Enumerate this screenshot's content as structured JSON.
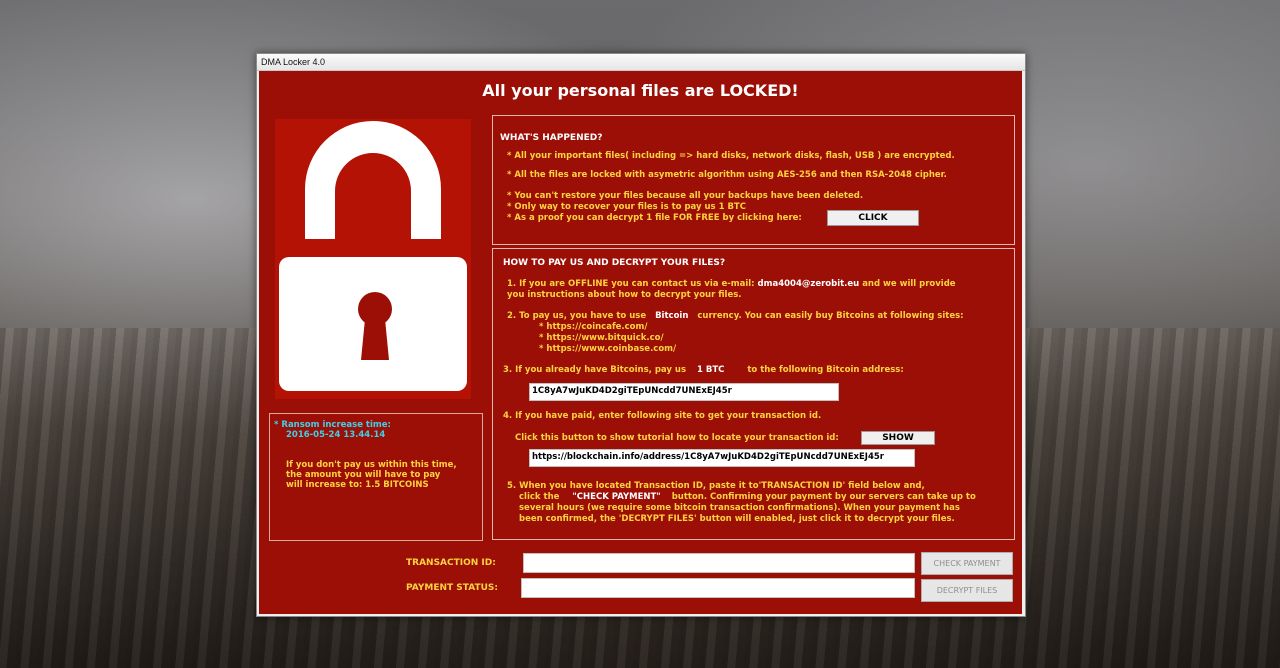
{
  "window": {
    "title": "DMA Locker 4.0"
  },
  "heading": "All your personal files are LOCKED!",
  "info_box": {
    "line1": "* Ransom increase time:",
    "line2": "2016-05-24 13.44.14",
    "line3": "If you don't pay us within this time,",
    "line4": "the amount you will have to pay",
    "line5": "will increase to:  1.5 BITCOINS"
  },
  "whats_happened": {
    "title": "WHAT'S HAPPENED?",
    "l1": "* All your important files( including => hard disks, network disks, flash, USB ) are encrypted.",
    "l2": "* All the files are locked with asymetric algorithm using AES-256 and then RSA-2048 cipher.",
    "l3": "* You can't restore your files because all your backups have been deleted.",
    "l4": "* Only way to recover your files is to pay us  1 BTC",
    "l5": "* As a proof you can decrypt 1 file FOR FREE by clicking here:",
    "click_label": "CLICK"
  },
  "how_to": {
    "title": "HOW TO PAY US AND DECRYPT YOUR FILES?",
    "s1a": "1. If you are OFFLINE you can contact us via e-mail:",
    "email": "dma4004@zerobit.eu",
    "s1b": "and we will provide",
    "s1c": "you instructions about how to decrypt your files.",
    "s2a": "2. To pay us, you have to use",
    "bitcoin": "Bitcoin",
    "s2b": "currency. You can easily buy Bitcoins at following sites:",
    "site1": "* https://coincafe.com/",
    "site2": "* https://www.bitquick.co/",
    "site3": "* https://www.coinbase.com/",
    "s3a": "3. If you already have Bitcoins, pay us",
    "amount": "1 BTC",
    "s3b": "to the following Bitcoin address:",
    "address": "1C8yA7wJuKD4D2giTEpUNcdd7UNExEJ45r",
    "s4": "4. If you have paid, enter following site to get your transaction id.",
    "s4b": "Click this button to show tutorial how to locate your transaction id:",
    "show_label": "SHOW",
    "blockchain_url": "https://blockchain.info/address/1C8yA7wJuKD4D2giTEpUNcdd7UNExEJ45r",
    "s5a": "5. When you have located Transaction ID, paste it to'TRANSACTION ID' field below and,",
    "s5b1": "click the",
    "check_quote": "\"CHECK PAYMENT\"",
    "s5b2": "button. Confirming your payment by our servers can take up to",
    "s5c": "several hours (we require some bitcoin transaction confirmations). When your payment has",
    "s5d": "been confirmed, the 'DECRYPT FILES' button will enabled, just click it to decrypt your files."
  },
  "bottom": {
    "transaction_label": "TRANSACTION ID:",
    "status_label": "PAYMENT STATUS:",
    "transaction_value": "",
    "status_value": "",
    "check_payment": "CHECK PAYMENT",
    "decrypt_files": "DECRYPT FILES"
  },
  "colors": {
    "background_red": "#9b0f06",
    "text_yellow": "#ffd33d",
    "info_cyan": "#3fd0e8"
  }
}
